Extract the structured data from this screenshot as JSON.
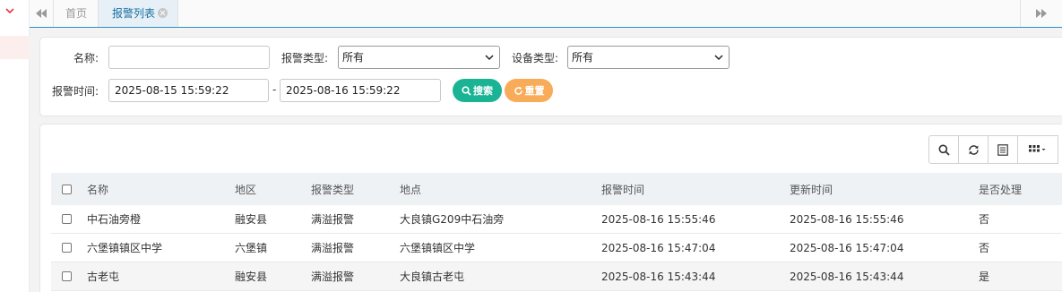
{
  "tabs": {
    "home": "首页",
    "active": "报警列表"
  },
  "search": {
    "name_label": "名称:",
    "name_value": "",
    "alarm_type_label": "报警类型:",
    "alarm_type_value": "所有",
    "device_type_label": "设备类型:",
    "device_type_value": "所有",
    "time_label": "报警时间:",
    "time_start": "2025-08-15 15:59:22",
    "time_sep": "-",
    "time_end": "2025-08-16 15:59:22",
    "search_button": "搜索",
    "reset_button": "重置"
  },
  "table": {
    "columns": [
      "名称",
      "地区",
      "报警类型",
      "地点",
      "报警时间",
      "更新时间",
      "是否处理"
    ],
    "rows": [
      [
        "中石油旁橙",
        "融安县",
        "满溢报警",
        "大良镇G209中石油旁",
        "2025-08-16 15:55:46",
        "2025-08-16 15:55:46",
        "否"
      ],
      [
        "六堡镇镇区中学",
        "六堡镇",
        "满溢报警",
        "六堡镇镇区中学",
        "2025-08-16 15:47:04",
        "2025-08-16 15:47:04",
        "否"
      ],
      [
        "古老屯",
        "融安县",
        "满溢报警",
        "大良镇古老屯",
        "2025-08-16 15:43:44",
        "2025-08-16 15:43:44",
        "是"
      ]
    ]
  },
  "icons": {
    "sidebar": "chevron-down-icon",
    "tab_left": "double-chevron-left-icon",
    "tab_right": "double-chevron-right-icon",
    "close": "close-circle-icon",
    "search": "search-icon",
    "refresh": "refresh-icon",
    "toggle": "list-icon",
    "columns": "grid-icon"
  },
  "colors": {
    "accent": "#1ab394",
    "warning": "#f8ac59",
    "tab_border": "#2f8fc6",
    "sidebar_chevron": "#e5393f"
  }
}
